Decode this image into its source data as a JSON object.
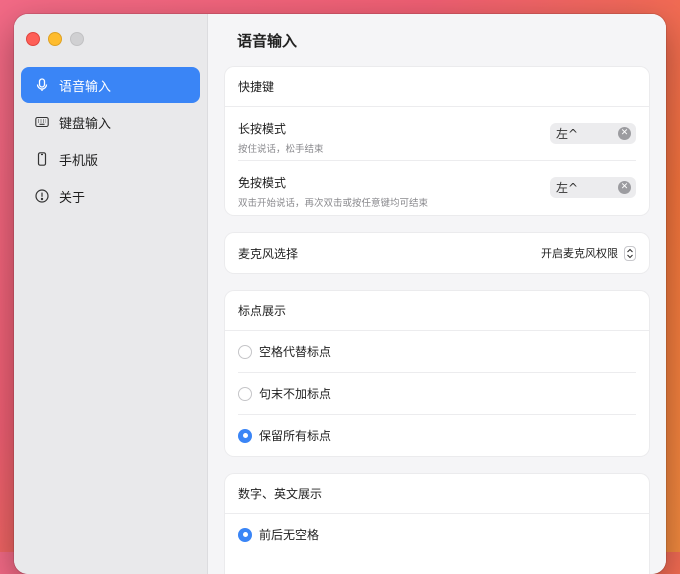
{
  "window": {
    "title": "语音输入"
  },
  "sidebar": {
    "items": [
      {
        "label": "语音输入",
        "icon": "microphone-icon",
        "active": true
      },
      {
        "label": "键盘输入",
        "icon": "keyboard-icon",
        "active": false
      },
      {
        "label": "手机版",
        "icon": "phone-icon",
        "active": false
      },
      {
        "label": "关于",
        "icon": "info-icon",
        "active": false
      }
    ]
  },
  "shortcuts": {
    "header": "快捷键",
    "long_press": {
      "title": "长按模式",
      "subtitle": "按住说话，松手结束",
      "key": "左^"
    },
    "hands_free": {
      "title": "免按模式",
      "subtitle": "双击开始说话，再次双击或按任意键均可结束",
      "key": "左^"
    }
  },
  "microphone": {
    "label": "麦克风选择",
    "value": "开启麦克风权限"
  },
  "punctuation": {
    "header": "标点展示",
    "options": [
      {
        "label": "空格代替标点",
        "checked": false
      },
      {
        "label": "句末不加标点",
        "checked": false
      },
      {
        "label": "保留所有标点",
        "checked": true
      }
    ]
  },
  "number_english": {
    "header": "数字、英文展示",
    "options": [
      {
        "label": "前后无空格",
        "checked": true
      }
    ]
  },
  "colors": {
    "accent": "#3a85f6"
  }
}
